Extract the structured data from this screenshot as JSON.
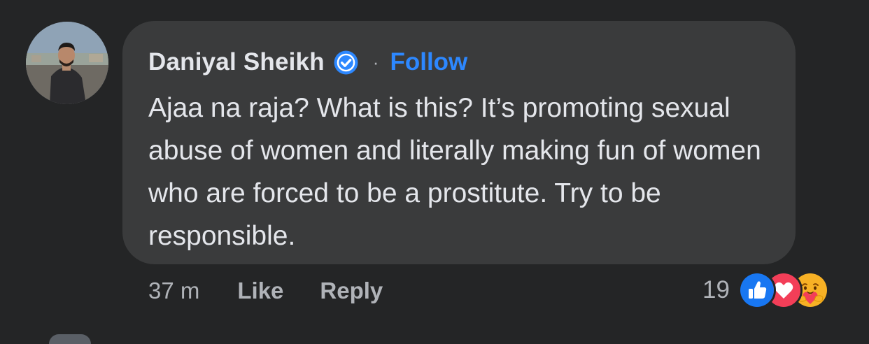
{
  "comment": {
    "author": {
      "name": "Daniyal Sheikh",
      "verified_icon": "verified-badge-icon",
      "separator": "·",
      "follow_label": "Follow"
    },
    "text": "Ajaa na raja? What is this? It’s promoting sexual abuse of women and literally making fun of women who are forced to be a prostitute. Try to be responsible.",
    "timestamp": "37 m",
    "actions": {
      "like_label": "Like",
      "reply_label": "Reply"
    },
    "reactions": {
      "count": "19",
      "types": [
        "like-reaction-icon",
        "love-reaction-icon",
        "care-reaction-icon"
      ]
    }
  },
  "colors": {
    "background": "#242526",
    "bubble": "#3a3b3c",
    "primary_text": "#e4e6eb",
    "secondary_text": "#b0b3b8",
    "link_blue": "#2d88ff",
    "like_blue": "#1877f2",
    "love_red": "#f33e58",
    "care_yellow": "#f7b125"
  }
}
